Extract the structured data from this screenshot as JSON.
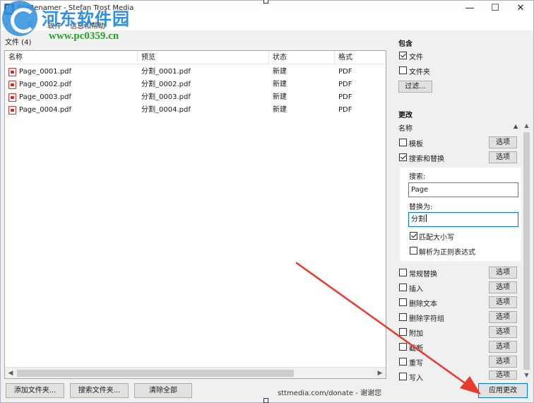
{
  "window": {
    "title": "FileRenamer - Stefan Trost Media",
    "controls": {
      "minimize": "—",
      "maximize": "☐",
      "close": "✕"
    }
  },
  "menu": {
    "items": [
      "软件",
      "信息和帮助"
    ]
  },
  "watermark": {
    "brand": "河东软件园",
    "url": "www.pc0359.cn"
  },
  "files_panel": {
    "label": "文件 (4)",
    "columns": [
      "名称",
      "预览",
      "状态",
      "格式"
    ],
    "rows": [
      {
        "name": "Page_0001.pdf",
        "preview": "分割_0001.pdf",
        "status": "新建",
        "format": "PDF"
      },
      {
        "name": "Page_0002.pdf",
        "preview": "分割_0002.pdf",
        "status": "新建",
        "format": "PDF"
      },
      {
        "name": "Page_0003.pdf",
        "preview": "分割_0003.pdf",
        "status": "新建",
        "format": "PDF"
      },
      {
        "name": "Page_0004.pdf",
        "preview": "分割_0004.pdf",
        "status": "新建",
        "format": "PDF"
      }
    ]
  },
  "bottom_bar": {
    "add_folder": "添加文件夹...",
    "search_folder": "搜索文件夹...",
    "clear_all": "清除全部",
    "donate": "sttmedia.com/donate - 谢谢您",
    "apply": "应用更改"
  },
  "include": {
    "title": "包含",
    "files": {
      "label": "文件",
      "checked": true
    },
    "folders": {
      "label": "文件夹",
      "checked": false
    },
    "filter_button": "过滤..."
  },
  "changes": {
    "title": "更改",
    "name_label": "名称",
    "options_label": "选项",
    "items": [
      {
        "label": "模板",
        "checked": false
      },
      {
        "label": "搜索和替换",
        "checked": true
      }
    ],
    "search_replace": {
      "search_label": "搜索:",
      "search_value": "Page",
      "replace_label": "替换为:",
      "replace_value": "分割",
      "match_case": {
        "label": "匹配大小写",
        "checked": true
      },
      "regex": {
        "label": "解析为正则表达式",
        "checked": false
      }
    },
    "more_items": [
      {
        "label": "常规替换",
        "checked": false
      },
      {
        "label": "插入",
        "checked": false
      },
      {
        "label": "删除文本",
        "checked": false
      },
      {
        "label": "删除字符组",
        "checked": false
      },
      {
        "label": "附加",
        "checked": false
      },
      {
        "label": "截断",
        "checked": false
      },
      {
        "label": "重写",
        "checked": false
      },
      {
        "label": "写入",
        "checked": false
      }
    ]
  },
  "colors": {
    "accent": "#0078d7",
    "annotation_arrow": "#e8392c",
    "watermark_blue": "#2f8fe0",
    "watermark_green": "#2aa12a"
  }
}
